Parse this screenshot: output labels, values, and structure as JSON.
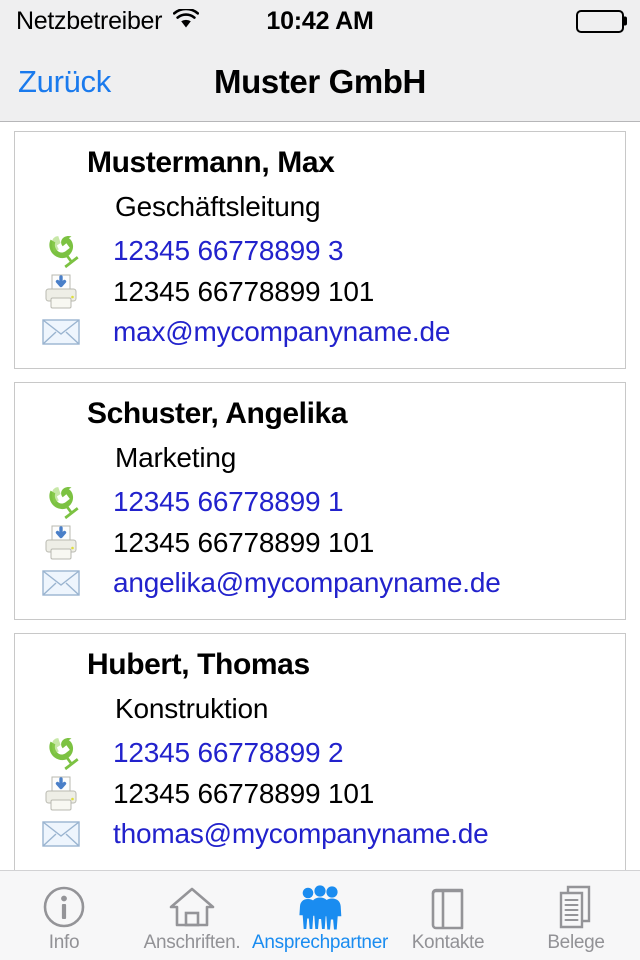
{
  "status_bar": {
    "carrier": "Netzbetreiber",
    "wifi_icon": "wifi-icon",
    "time": "10:42 AM",
    "battery_icon": "battery-full-icon"
  },
  "nav_bar": {
    "back_label": "Zurück",
    "title": "Muster GmbH"
  },
  "colors": {
    "tint_blue": "#1a7aed",
    "tab_active_blue": "#1a8cf0",
    "link_blue": "#2222cc",
    "bar_background": "#efeff0",
    "tab_background": "#f7f7f8",
    "card_border": "#c8c8c8",
    "phone_icon_green": "#76c043"
  },
  "contacts": [
    {
      "name": "Mustermann, Max",
      "role": "Geschäftsleitung",
      "phone": "12345 66778899 3",
      "fax": "12345 66778899 101",
      "email": "max@mycompanyname.de",
      "phone_icon": "phone-handset-icon",
      "fax_icon": "fax-printer-icon",
      "email_icon": "envelope-icon"
    },
    {
      "name": "Schuster, Angelika",
      "role": "Marketing",
      "phone": "12345 66778899 1",
      "fax": "12345 66778899 101",
      "email": "angelika@mycompanyname.de",
      "phone_icon": "phone-handset-icon",
      "fax_icon": "fax-printer-icon",
      "email_icon": "envelope-icon"
    },
    {
      "name": "Hubert, Thomas",
      "role": "Konstruktion",
      "phone": "12345 66778899 2",
      "fax": "12345 66778899 101",
      "email": "thomas@mycompanyname.de",
      "phone_icon": "phone-handset-icon",
      "fax_icon": "fax-printer-icon",
      "email_icon": "envelope-icon"
    }
  ],
  "tab_bar": {
    "items": [
      {
        "label": "Info",
        "icon": "info-circle-icon",
        "active": false
      },
      {
        "label": "Anschriften.",
        "icon": "house-icon",
        "active": false
      },
      {
        "label": "Ansprechpartner",
        "icon": "people-group-icon",
        "active": true
      },
      {
        "label": "Kontakte",
        "icon": "address-book-icon",
        "active": false
      },
      {
        "label": "Belege",
        "icon": "documents-icon",
        "active": false
      }
    ]
  }
}
